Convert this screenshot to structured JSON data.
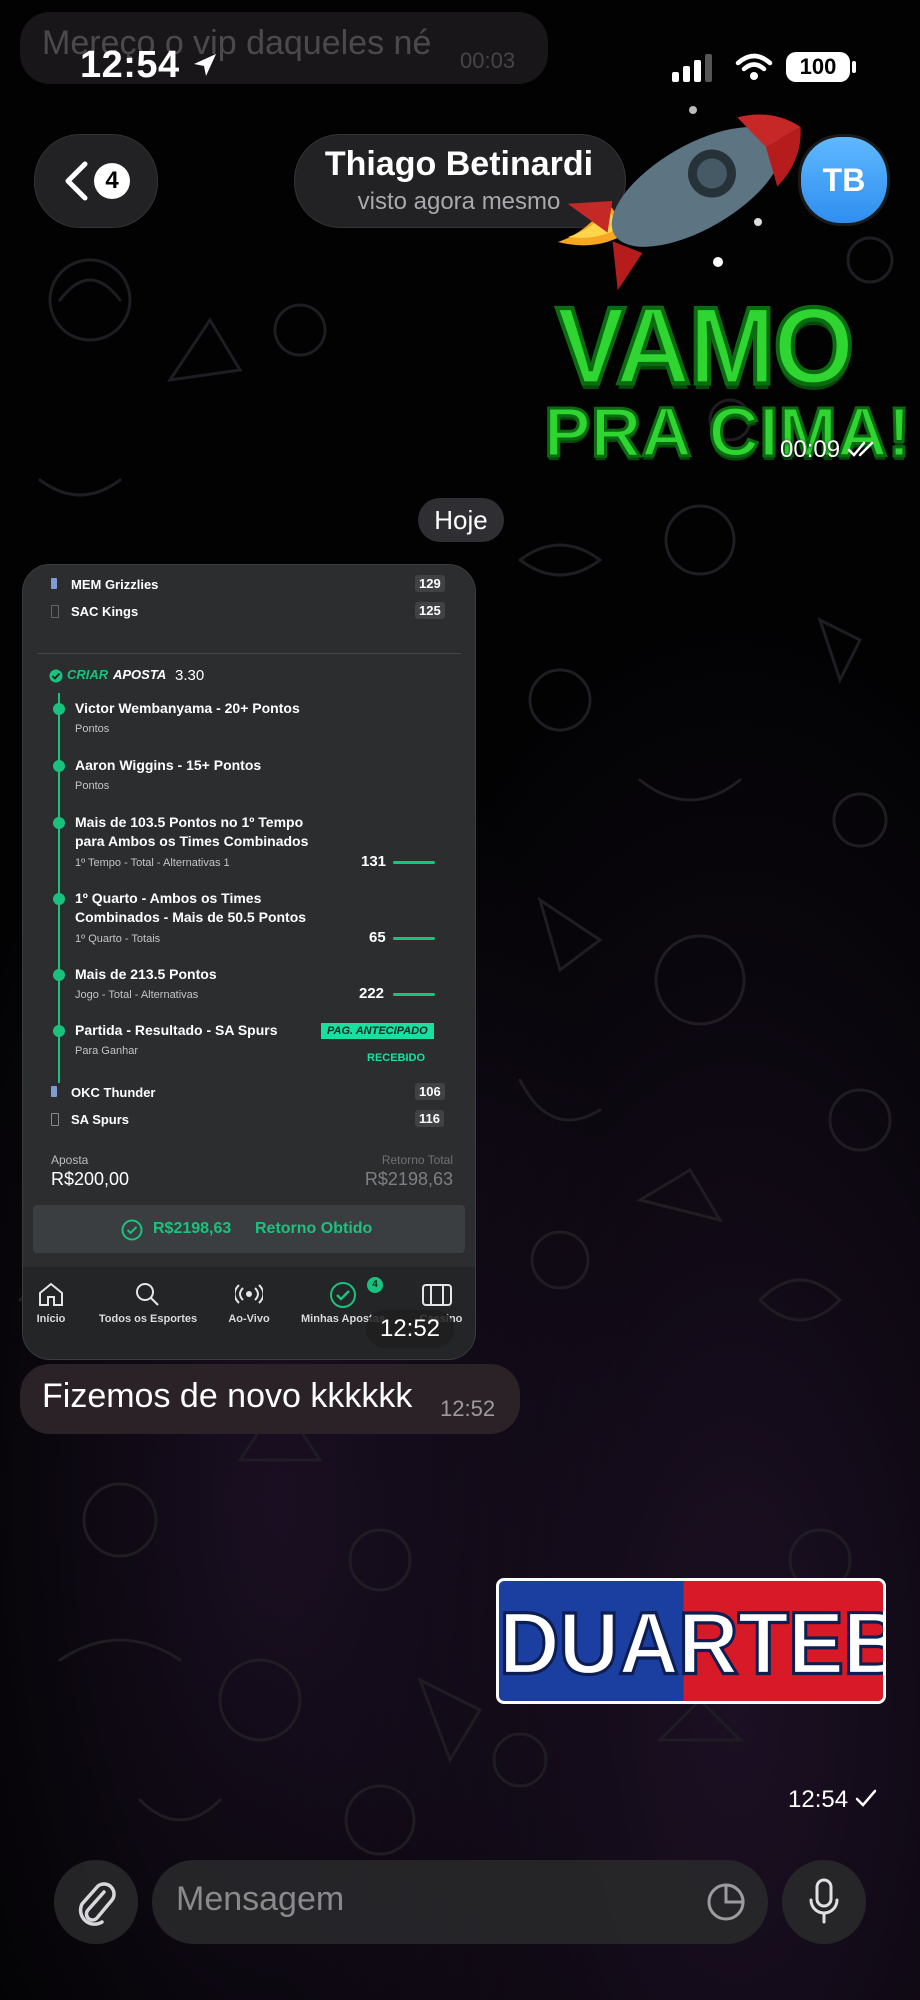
{
  "status_bar": {
    "time": "12:54",
    "battery": "100"
  },
  "previous_message": {
    "text": "Mereço o vip daqueles né",
    "time": "00:03"
  },
  "header": {
    "back_count": "4",
    "contact_name": "Thiago Betinardi",
    "contact_status": "visto agora mesmo",
    "avatar_initials": "TB"
  },
  "sticker": {
    "line1": "VAMO",
    "line2": "PRA CIMA!",
    "time": "00:09"
  },
  "date_separator": "Hoje",
  "bet_screenshot": {
    "team1": {
      "name": "MEM Grizzlies",
      "score": "129"
    },
    "team2": {
      "name": "SAC Kings",
      "score": "125"
    },
    "criar": "CRIAR",
    "aposta_label": "APOSTA",
    "odds": "3.30",
    "selections": [
      {
        "title1": "Victor Wembanyama - 20+ Pontos",
        "title2": "",
        "sub": "Pontos",
        "value": ""
      },
      {
        "title1": "Aaron Wiggins - 15+ Pontos",
        "title2": "",
        "sub": "Pontos",
        "value": ""
      },
      {
        "title1": "Mais de 103.5 Pontos no 1º Tempo",
        "title2": "para Ambos os Times Combinados",
        "sub": "1º Tempo - Total - Alternativas 1",
        "value": "131"
      },
      {
        "title1": "1º Quarto - Ambos os Times",
        "title2": "Combinados - Mais de 50.5 Pontos",
        "sub": "1º Quarto - Totais",
        "value": "65"
      },
      {
        "title1": "Mais de 213.5 Pontos",
        "title2": "",
        "sub": "Jogo - Total - Alternativas",
        "value": "222"
      },
      {
        "title1": "Partida - Resultado - SA Spurs",
        "title2": "",
        "sub": "Para Ganhar",
        "value": ""
      }
    ],
    "pag_antecipado": "PAG. ANTECIPADO",
    "recebido": "RECEBIDO",
    "team3": {
      "name": "OKC Thunder",
      "score": "106"
    },
    "team4": {
      "name": "SA Spurs",
      "score": "116"
    },
    "aposta_caption": "Aposta",
    "aposta_value": "R$200,00",
    "retorno_caption": "Retorno Total",
    "retorno_value": "R$2198,63",
    "obtido_value": "R$2198,63",
    "obtido_label": "Retorno Obtido",
    "nav": [
      "Início",
      "Todos os Esportes",
      "Ao-Vivo",
      "Minhas Apostas",
      "Cassino"
    ],
    "nav_badge": "4",
    "time": "12:52"
  },
  "message": {
    "text": "Fizemos de novo kkkkkk",
    "time": "12:52"
  },
  "duartebet_sticker": {
    "text": "DUARTEBET",
    "time": "12:54"
  },
  "input": {
    "placeholder": "Mensagem"
  },
  "colors": {
    "accent_green": "#19c37d",
    "avatar_blue": "#3a9cf5"
  }
}
